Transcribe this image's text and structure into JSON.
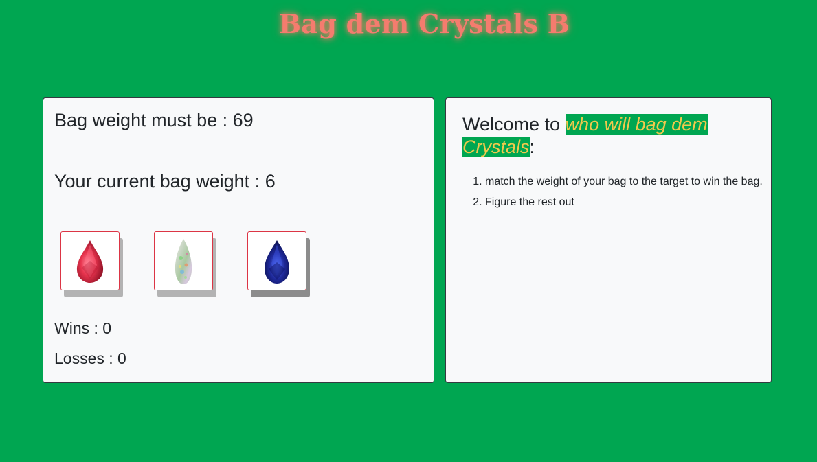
{
  "title": "Bag dem Crystals B",
  "game": {
    "target_label": "Bag weight must be : ",
    "target_value": "69",
    "current_label": "Your current bag weight : ",
    "current_value": "6",
    "wins_label": "Wins : ",
    "wins_value": "0",
    "losses_label": "Losses : ",
    "losses_value": "0",
    "crystals": [
      {
        "name": "ruby-crystal",
        "color": "#e8344e"
      },
      {
        "name": "opal-crystal",
        "color": "#c9d6c4"
      },
      {
        "name": "sapphire-crystal",
        "color": "#1f2a9c"
      }
    ]
  },
  "instructions": {
    "welcome_prefix": "Welcome to ",
    "welcome_highlight": "who will bag dem Crystals",
    "welcome_suffix": ":",
    "rules": [
      "match the weight of your bag to the target to win the bag.",
      "Figure the rest out"
    ]
  },
  "colors": {
    "background": "#00a651",
    "title": "#f47c6e",
    "highlight_text": "#f2c94c",
    "crystal_border": "#dc3545"
  }
}
